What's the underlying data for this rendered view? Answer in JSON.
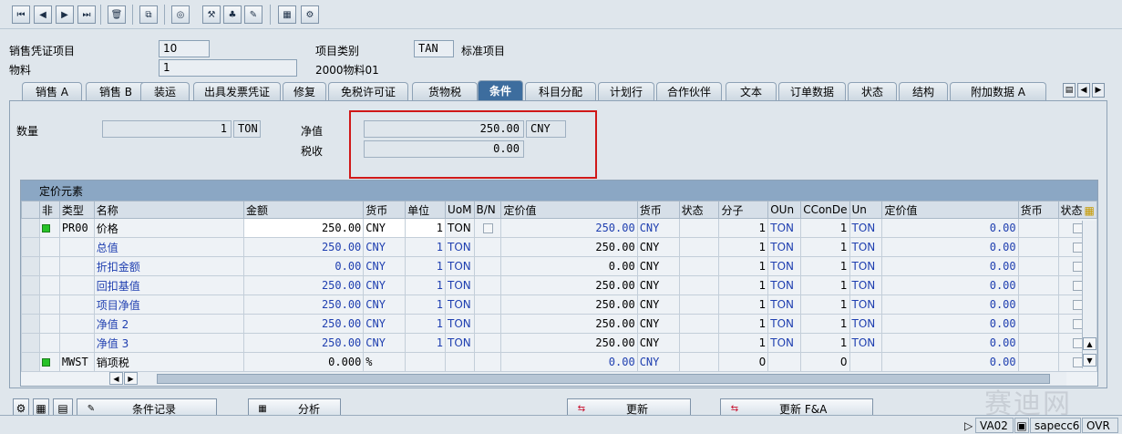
{
  "toolbar": {
    "icons": [
      "first-page-icon",
      "prev-page-icon",
      "next-page-icon",
      "last-page-icon",
      "delete-icon",
      "copy-icon",
      "display-icon",
      "material-icon",
      "partner-icon",
      "edit-icon",
      "calculator-icon",
      "config-icon"
    ]
  },
  "header": {
    "sales_doc_item_label": "销售凭证项目",
    "sales_doc_item_value": "10",
    "material_label": "物料",
    "material_value": "1",
    "item_category_label": "项目类别",
    "item_category_value": "TAN",
    "item_category_desc": "标准项目",
    "material_desc": "2000物料01"
  },
  "tabs": [
    "销售 A",
    "销售 B",
    "装运",
    "出具发票凭证",
    "修复",
    "免税许可证",
    "货物税",
    "条件",
    "科目分配",
    "计划行",
    "合作伙伴",
    "文本",
    "订单数据",
    "状态",
    "结构",
    "附加数据 A"
  ],
  "active_tab": "条件",
  "summary": {
    "quantity_label": "数量",
    "quantity_value": "1",
    "quantity_unit": "TON",
    "net_value_label": "净值",
    "net_value": "250.00",
    "net_currency": "CNY",
    "tax_label": "税收",
    "tax_value": "0.00"
  },
  "pricing": {
    "title": "定价元素",
    "columns": [
      "非",
      "类型",
      "名称",
      "金额",
      "货币",
      "单位",
      "UoM",
      "B/N",
      "定价值",
      "货币",
      "状态",
      "分子",
      "OUn",
      "CConDe",
      "Un",
      "定价值",
      "货币",
      "状态"
    ],
    "rows": [
      {
        "ind": "green",
        "type": "PR00",
        "name": "价格",
        "amount": "250.00",
        "curr": "CNY",
        "unit": "1",
        "uom": "TON",
        "bn": "chk",
        "cvalue": "250.00",
        "ccurr": "CNY",
        "status": "",
        "num": "1",
        "oun": "TON",
        "ccon": "1",
        "un": "TON",
        "cvalue2": "0.00",
        "curr2": "",
        "status2": "chk",
        "blue": false
      },
      {
        "ind": "",
        "type": "",
        "name": "总值",
        "amount": "250.00",
        "curr": "CNY",
        "unit": "1",
        "uom": "TON",
        "bn": "",
        "cvalue": "250.00",
        "ccurr": "CNY",
        "status": "",
        "num": "1",
        "oun": "TON",
        "ccon": "1",
        "un": "TON",
        "cvalue2": "0.00",
        "curr2": "",
        "status2": "chk",
        "blue": true
      },
      {
        "ind": "",
        "type": "",
        "name": "折扣金额",
        "amount": "0.00",
        "curr": "CNY",
        "unit": "1",
        "uom": "TON",
        "bn": "",
        "cvalue": "0.00",
        "ccurr": "CNY",
        "status": "",
        "num": "1",
        "oun": "TON",
        "ccon": "1",
        "un": "TON",
        "cvalue2": "0.00",
        "curr2": "",
        "status2": "chk",
        "blue": true
      },
      {
        "ind": "",
        "type": "",
        "name": "回扣基值",
        "amount": "250.00",
        "curr": "CNY",
        "unit": "1",
        "uom": "TON",
        "bn": "",
        "cvalue": "250.00",
        "ccurr": "CNY",
        "status": "",
        "num": "1",
        "oun": "TON",
        "ccon": "1",
        "un": "TON",
        "cvalue2": "0.00",
        "curr2": "",
        "status2": "chk",
        "blue": true
      },
      {
        "ind": "",
        "type": "",
        "name": "项目净值",
        "amount": "250.00",
        "curr": "CNY",
        "unit": "1",
        "uom": "TON",
        "bn": "",
        "cvalue": "250.00",
        "ccurr": "CNY",
        "status": "",
        "num": "1",
        "oun": "TON",
        "ccon": "1",
        "un": "TON",
        "cvalue2": "0.00",
        "curr2": "",
        "status2": "chk",
        "blue": true
      },
      {
        "ind": "",
        "type": "",
        "name": "净值 2",
        "amount": "250.00",
        "curr": "CNY",
        "unit": "1",
        "uom": "TON",
        "bn": "",
        "cvalue": "250.00",
        "ccurr": "CNY",
        "status": "",
        "num": "1",
        "oun": "TON",
        "ccon": "1",
        "un": "TON",
        "cvalue2": "0.00",
        "curr2": "",
        "status2": "chk",
        "blue": true
      },
      {
        "ind": "",
        "type": "",
        "name": "净值 3",
        "amount": "250.00",
        "curr": "CNY",
        "unit": "1",
        "uom": "TON",
        "bn": "",
        "cvalue": "250.00",
        "ccurr": "CNY",
        "status": "",
        "num": "1",
        "oun": "TON",
        "ccon": "1",
        "un": "TON",
        "cvalue2": "0.00",
        "curr2": "",
        "status2": "chk",
        "blue": true
      },
      {
        "ind": "green",
        "type": "MWST",
        "name": "销项税",
        "amount": "0.000",
        "curr": "%",
        "unit": "",
        "uom": "",
        "bn": "",
        "cvalue": "0.00",
        "ccurr": "CNY",
        "status": "",
        "num": "0",
        "oun": "",
        "ccon": "0",
        "un": "",
        "cvalue2": "0.00",
        "curr2": "",
        "status2": "chk",
        "blue": false
      }
    ]
  },
  "buttons": {
    "condition_record": "条件记录",
    "analysis": "分析",
    "update": "更新",
    "update_fa": "更新 F&A"
  },
  "status": {
    "transaction": "VA02",
    "system": "sapecc6",
    "mode": "OVR"
  },
  "watermark": "赛迪网"
}
